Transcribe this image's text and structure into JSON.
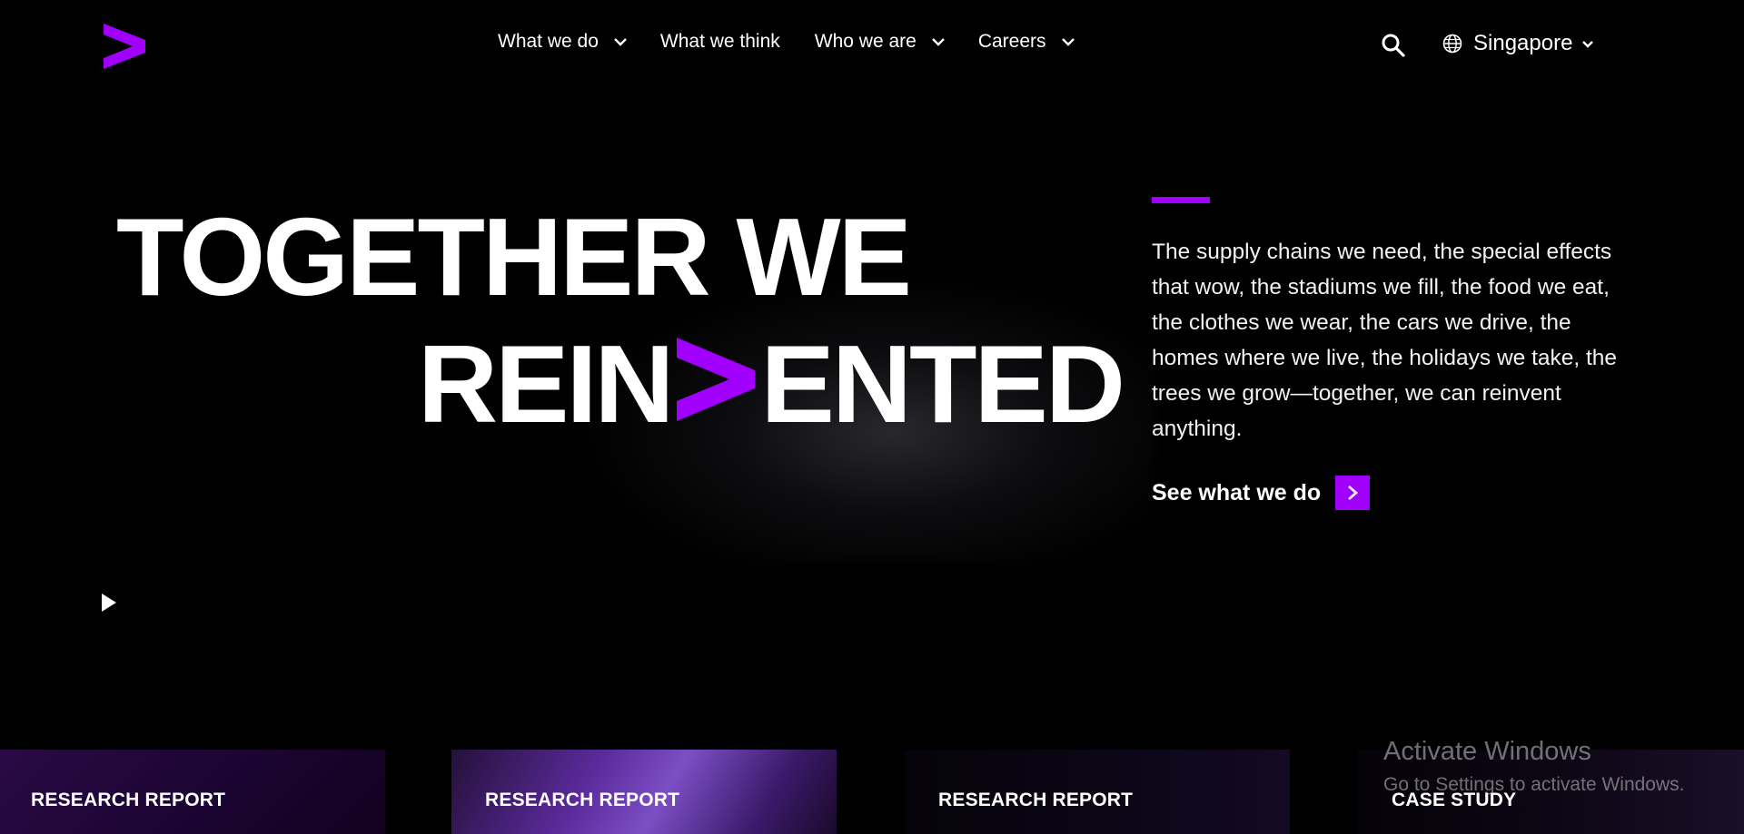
{
  "header": {
    "logo_icon": "accenture-greater-than-logo",
    "nav": [
      {
        "label": "What we do",
        "has_dropdown": true
      },
      {
        "label": "What we think",
        "has_dropdown": false
      },
      {
        "label": "Who we are",
        "has_dropdown": true
      },
      {
        "label": "Careers",
        "has_dropdown": true
      }
    ],
    "search_icon": "search-icon",
    "region": {
      "icon": "globe-icon",
      "label": "Singapore"
    }
  },
  "hero": {
    "headline_line1": "TOGETHER WE",
    "headline_line2_before": "REIN",
    "headline_line2_after": "ENTED",
    "description": "The supply chains we need, the special effects that wow, the stadiums we fill, the food we eat, the clothes we wear, the cars we drive, the homes where we live, the holidays we take, the trees we grow—together, we can reinvent anything.",
    "cta_label": "See what we do",
    "play_icon": "play-icon"
  },
  "cards": [
    {
      "label": "RESEARCH REPORT"
    },
    {
      "label": "RESEARCH REPORT"
    },
    {
      "label": "RESEARCH REPORT"
    },
    {
      "label": "CASE STUDY"
    }
  ],
  "watermark": {
    "title": "Activate Windows",
    "subtitle": "Go to Settings to activate Windows."
  },
  "colors": {
    "accent": "#a100ff",
    "background": "#000000",
    "text": "#ffffff"
  }
}
